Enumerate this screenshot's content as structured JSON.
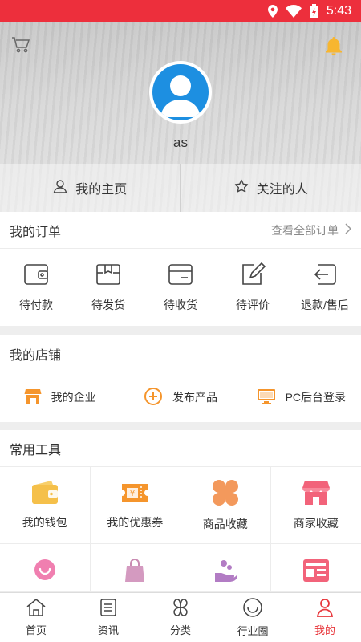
{
  "status_bar": {
    "time": "5:43",
    "background": "#ed2f3c"
  },
  "header": {
    "username": "as",
    "left_icon": "cart-icon",
    "right_icon": "bell-icon",
    "tabs": [
      {
        "label": "我的主页",
        "icon": "person-icon"
      },
      {
        "label": "关注的人",
        "icon": "star-icon"
      }
    ]
  },
  "orders": {
    "title": "我的订单",
    "view_all": "查看全部订单",
    "items": [
      {
        "label": "待付款",
        "icon": "wallet-icon"
      },
      {
        "label": "待发货",
        "icon": "package-icon"
      },
      {
        "label": "待收货",
        "icon": "receive-box-icon"
      },
      {
        "label": "待评价",
        "icon": "edit-icon"
      },
      {
        "label": "退款/售后",
        "icon": "return-icon"
      }
    ]
  },
  "shop": {
    "title": "我的店铺",
    "items": [
      {
        "label": "我的企业",
        "icon": "store-icon"
      },
      {
        "label": "发布产品",
        "icon": "plus-circle-icon"
      },
      {
        "label": "PC后台登录",
        "icon": "monitor-icon"
      }
    ]
  },
  "tools": {
    "title": "常用工具",
    "items": [
      {
        "label": "我的钱包",
        "icon": "wallet-icon"
      },
      {
        "label": "我的优惠券",
        "icon": "coupon-icon"
      },
      {
        "label": "商品收藏",
        "icon": "clover-icon"
      },
      {
        "label": "商家收藏",
        "icon": "shop-icon"
      }
    ],
    "row2_icons": [
      "smile-icon",
      "shopping-bag-icon",
      "hand-icon",
      "news-icon"
    ]
  },
  "bottom_nav": {
    "items": [
      {
        "label": "首页",
        "icon": "home-icon"
      },
      {
        "label": "资讯",
        "icon": "document-icon"
      },
      {
        "label": "分类",
        "icon": "clover-outline-icon"
      },
      {
        "label": "行业圈",
        "icon": "circle-smile-icon"
      },
      {
        "label": "我的",
        "icon": "person-icon"
      }
    ],
    "active_index": 4,
    "active_color": "#e8383d"
  },
  "colors": {
    "accent_red": "#e8383d",
    "orange": "#f5952c",
    "yellow": "#f5c04a",
    "pink": "#f2637a",
    "purple": "#b27cc4"
  }
}
